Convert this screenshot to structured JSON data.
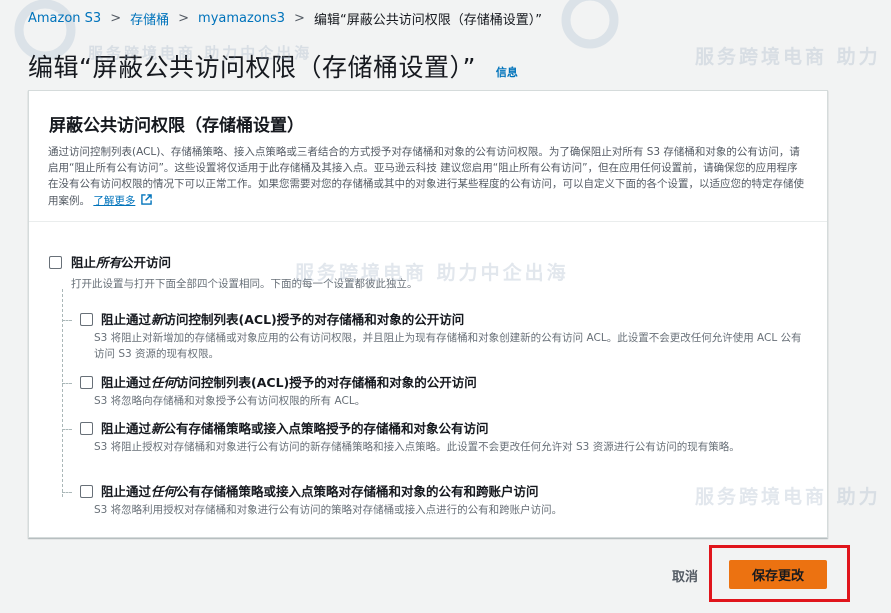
{
  "breadcrumb": {
    "items": [
      "Amazon S3",
      "存储桶",
      "myamazons3"
    ],
    "current": "编辑“屏蔽公共访问权限（存储桶设置）”"
  },
  "page": {
    "title": "编辑“屏蔽公共访问权限（存储桶设置）”",
    "info": "信息"
  },
  "panel": {
    "title": "屏蔽公共访问权限（存储桶设置）",
    "description": "通过访问控制列表(ACL)、存储桶策略、接入点策略或三者结合的方式授予对存储桶和对象的公有访问权限。为了确保阻止对所有 S3 存储桶和对象的公有访问，请启用“阻止所有公有访问”。这些设置将仅适用于此存储桶及其接入点。亚马逊云科技 建议您启用“阻止所有公有访问”，但在应用任何设置前，请确保您的应用程序在没有公有访问权限的情况下可以正常工作。如果您需要对您的存储桶或其中的对象进行某些程度的公有访问，可以自定义下面的各个设置，以适应您的特定存储使用案例。",
    "learn_more": "了解更多"
  },
  "options": {
    "all": {
      "label_prefix": "阻止",
      "label_em": "所有",
      "label_suffix": "公开访问",
      "desc": "打开此设置与打开下面全部四个设置相同。下面的每一个设置都彼此独立。"
    },
    "sub": [
      {
        "label_prefix": "阻止通过",
        "label_em": "新",
        "label_suffix": "访问控制列表(ACL)授予的对存储桶和对象的公开访问",
        "desc": "S3 将阻止对新增加的存储桶或对象应用的公有访问权限，并且阻止为现有存储桶和对象创建新的公有访问 ACL。此设置不会更改任何允许使用 ACL 公有访问 S3 资源的现有权限。"
      },
      {
        "label_prefix": "阻止通过",
        "label_em": "任何",
        "label_suffix": "访问控制列表(ACL)授予的对存储桶和对象的公开访问",
        "desc": "S3 将忽略向存储桶和对象授予公有访问权限的所有 ACL。"
      },
      {
        "label_prefix": "阻止通过",
        "label_em": "新",
        "label_suffix": "公有存储桶策略或接入点策略授予的存储桶和对象公有访问",
        "desc": "S3 将阻止授权对存储桶和对象进行公有访问的新存储桶策略和接入点策略。此设置不会更改任何允许对 S3 资源进行公有访问的现有策略。"
      },
      {
        "label_prefix": "阻止通过",
        "label_em": "任何",
        "label_suffix": "公有存储桶策略或接入点策略对存储桶和对象的公有和跨账户访问",
        "desc": "S3 将忽略利用授权对存储桶和对象进行公有访问的策略对存储桶或接入点进行的公有和跨账户访问。"
      }
    ]
  },
  "actions": {
    "cancel": "取消",
    "save": "保存更改"
  },
  "watermark": {
    "text1": "服务跨境电商  助力中企出海",
    "text2": "服务跨境电商  助力"
  },
  "colors": {
    "link": "#0073bb",
    "primary_button": "#ec7211",
    "highlight": "#e0151b"
  }
}
